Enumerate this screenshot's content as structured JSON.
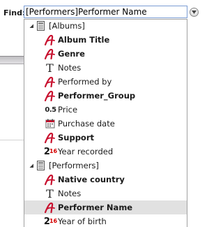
{
  "find": {
    "label": "Find:",
    "value": "[Performers]Performer Name"
  },
  "tree": [
    {
      "type": "table",
      "label": "[Albums]",
      "expanded": true
    },
    {
      "type": "field",
      "icon": "alpha-icon",
      "label": "Album Title",
      "bold": true
    },
    {
      "type": "field",
      "icon": "alpha-icon",
      "label": "Genre",
      "bold": true
    },
    {
      "type": "field",
      "icon": "text-icon",
      "label": "Notes",
      "bold": false
    },
    {
      "type": "field",
      "icon": "alpha-icon",
      "label": "Performed by",
      "bold": false
    },
    {
      "type": "field",
      "icon": "alpha-icon",
      "label": "Performer_Group",
      "bold": true
    },
    {
      "type": "field",
      "icon": "real-icon",
      "icon_text": "0.5",
      "label": "Price",
      "bold": false
    },
    {
      "type": "field",
      "icon": "date-icon",
      "label": "Purchase date",
      "bold": false
    },
    {
      "type": "field",
      "icon": "alpha-icon",
      "label": "Support",
      "bold": true
    },
    {
      "type": "field",
      "icon": "integer-icon",
      "icon_text": "2",
      "icon_sup": "16",
      "label": "Year recorded",
      "bold": false
    },
    {
      "type": "table",
      "label": "[Performers]",
      "expanded": true
    },
    {
      "type": "field",
      "icon": "alpha-icon",
      "label": "Native country",
      "bold": true
    },
    {
      "type": "field",
      "icon": "text-icon",
      "label": "Notes",
      "bold": false
    },
    {
      "type": "field",
      "icon": "alpha-icon",
      "label": "Performer Name",
      "bold": true,
      "selected": true
    },
    {
      "type": "field",
      "icon": "integer-icon",
      "icon_text": "2",
      "icon_sup": "16",
      "label": "Year of birth",
      "bold": false
    }
  ],
  "colors": {
    "alpha_icon": "#c8102e",
    "selection": "#e1e1e1",
    "input_border": "#7a9cd3"
  }
}
